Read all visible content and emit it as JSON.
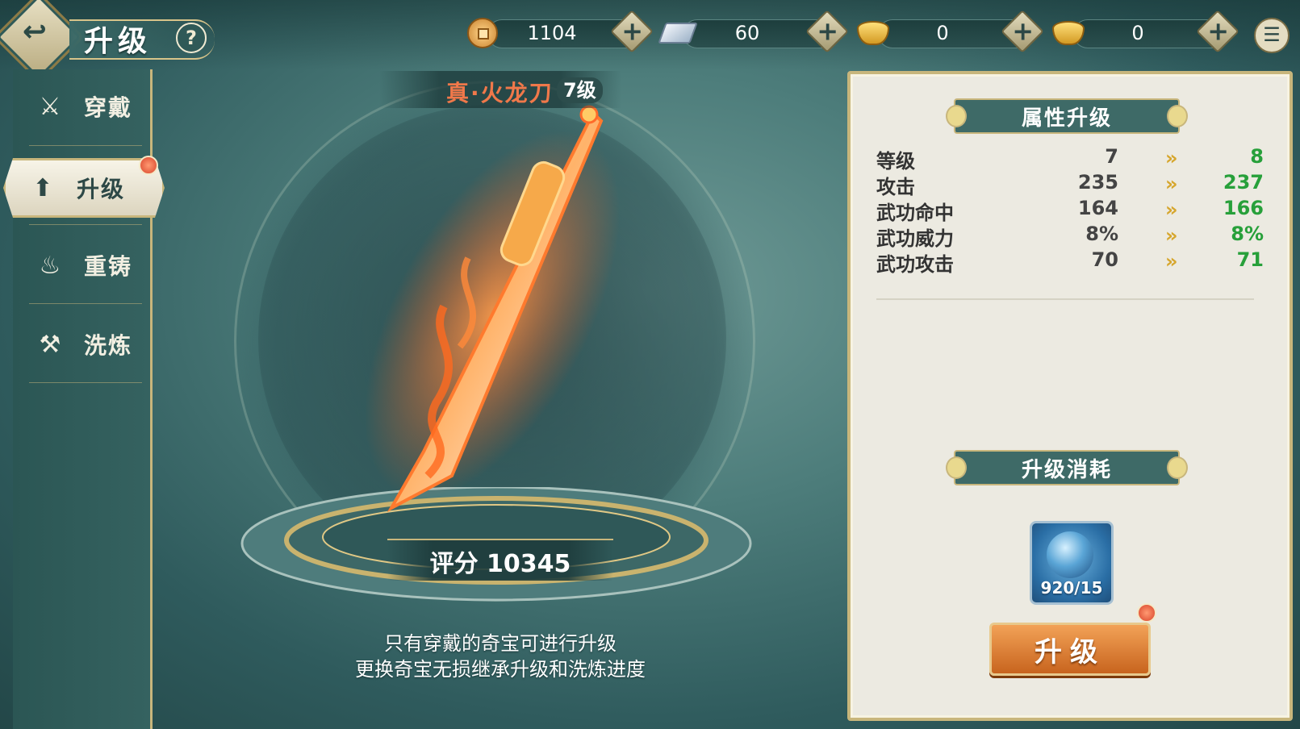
{
  "header": {
    "title": "升级",
    "back_icon": "back-arrow-icon",
    "help_label": "?"
  },
  "currencies": [
    {
      "icon": "copper-coin-icon",
      "value": "1104"
    },
    {
      "icon": "silver-ingot-icon",
      "value": "60"
    },
    {
      "icon": "bound-gold-ingot-icon",
      "value": "0"
    },
    {
      "icon": "gold-ingot-icon",
      "value": "0"
    }
  ],
  "sidebar": {
    "items": [
      {
        "label": "穿戴",
        "icon": "crossed-swords-icon"
      },
      {
        "label": "升级",
        "icon": "upgrade-arrow-icon"
      },
      {
        "label": "重铸",
        "icon": "flame-icon"
      },
      {
        "label": "洗炼",
        "icon": "anvil-icon"
      }
    ]
  },
  "weapon": {
    "name": "真·火龙刀",
    "level": "7级",
    "score": "评分 10345"
  },
  "hints": [
    "只有穿戴的奇宝可进行升级",
    "更换奇宝无损继承升级和洗炼进度"
  ],
  "panel": {
    "attr_header": "属性升级",
    "stats": [
      {
        "name": "等级",
        "current": "7",
        "next": "8"
      },
      {
        "name": "攻击",
        "current": "235",
        "next": "237"
      },
      {
        "name": "武功命中",
        "current": "164",
        "next": "166"
      },
      {
        "name": "武功威力",
        "current": "8%",
        "next": "8%"
      },
      {
        "name": "武功攻击",
        "current": "70",
        "next": "71"
      }
    ],
    "cost_header": "升级消耗",
    "material": {
      "icon": "dragon-orb-icon",
      "count": "920/15"
    },
    "upgrade_button": "升级"
  },
  "colors": {
    "accent_gold": "#c8b67c",
    "next_value_green": "#27a03a",
    "weapon_name_orange": "#f0784a",
    "button_orange": "#d9782e"
  }
}
